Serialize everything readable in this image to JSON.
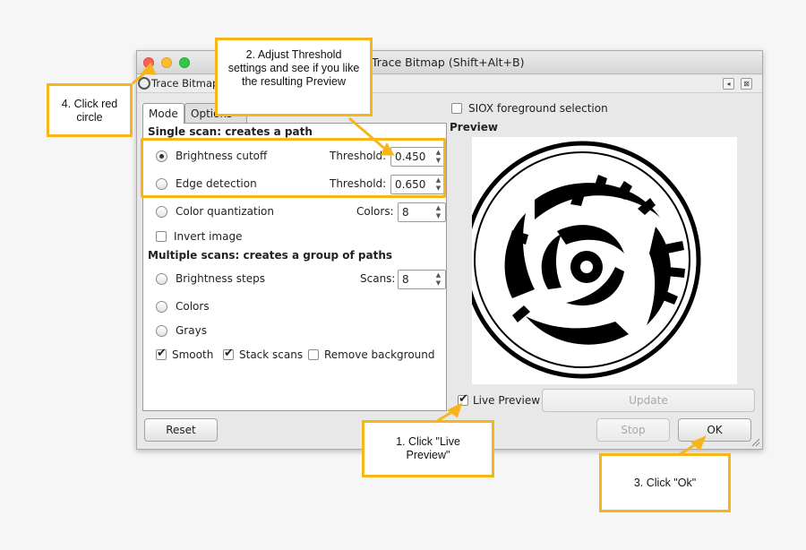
{
  "window": {
    "title": "Trace Bitmap (Shift+Alt+B)"
  },
  "panel": {
    "title": "Trace Bitmap",
    "buttons": [
      "◂",
      "⊠"
    ]
  },
  "tabs": [
    {
      "label": "Mode",
      "active": true
    },
    {
      "label": "Options",
      "active": false
    }
  ],
  "single_scan": {
    "heading": "Single scan: creates a path",
    "options": [
      {
        "label": "Brightness cutoff",
        "selected": true,
        "field_label": "Threshold:",
        "value": "0.450"
      },
      {
        "label": "Edge detection",
        "selected": false,
        "field_label": "Threshold:",
        "value": "0.650"
      },
      {
        "label": "Color quantization",
        "selected": false,
        "field_label": "Colors:",
        "value": "8"
      }
    ],
    "invert_label": "Invert image",
    "invert_checked": false
  },
  "multi_scan": {
    "heading": "Multiple scans: creates a group of paths",
    "options": [
      {
        "label": "Brightness steps",
        "selected": false,
        "field_label": "Scans:",
        "value": "8"
      },
      {
        "label": "Colors",
        "selected": false
      },
      {
        "label": "Grays",
        "selected": false
      }
    ],
    "checks": [
      {
        "label": "Smooth",
        "checked": true
      },
      {
        "label": "Stack scans",
        "checked": true
      },
      {
        "label": "Remove background",
        "checked": false
      }
    ]
  },
  "siox": {
    "label": "SIOX foreground selection",
    "checked": false
  },
  "preview": {
    "heading": "Preview",
    "live_label": "Live Preview",
    "live_checked": true,
    "update_label": "Update"
  },
  "buttons": {
    "reset": "Reset",
    "stop": "Stop",
    "ok": "OK"
  },
  "callouts": {
    "step1": "1. Click \"Live Preview\"",
    "step2": "2. Adjust Threshold settings and see if you like the resulting Preview",
    "step3": "3. Click \"Ok\"",
    "step4": "4. Click red circle"
  },
  "colors": {
    "accent": "#f5b51b",
    "close": "#fc5f57",
    "minimize": "#fdbc2e",
    "zoom": "#33c748"
  },
  "icons": {
    "check": "✔",
    "spin_up": "▲",
    "spin_down": "▼"
  }
}
